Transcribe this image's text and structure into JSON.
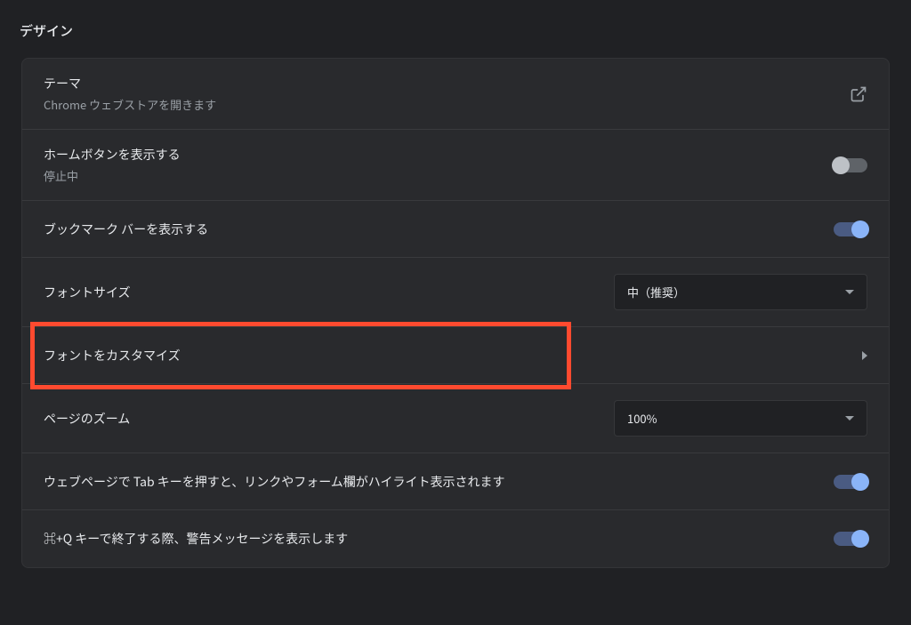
{
  "section": {
    "title": "デザイン"
  },
  "rows": {
    "theme": {
      "title": "テーマ",
      "sub": "Chrome ウェブストアを開きます"
    },
    "home_button": {
      "title": "ホームボタンを表示する",
      "sub": "停止中",
      "toggle": false
    },
    "bookmarks_bar": {
      "title": "ブックマーク バーを表示する",
      "toggle": true
    },
    "font_size": {
      "title": "フォントサイズ",
      "value": "中（推奨）"
    },
    "customize_fonts": {
      "title": "フォントをカスタマイズ"
    },
    "page_zoom": {
      "title": "ページのズーム",
      "value": "100%"
    },
    "tab_highlight": {
      "title": "ウェブページで Tab キーを押すと、リンクやフォーム欄がハイライト表示されます",
      "toggle": true
    },
    "quit_warning": {
      "title": "⌘+Q キーで終了する際、警告メッセージを表示します",
      "toggle": true
    }
  }
}
